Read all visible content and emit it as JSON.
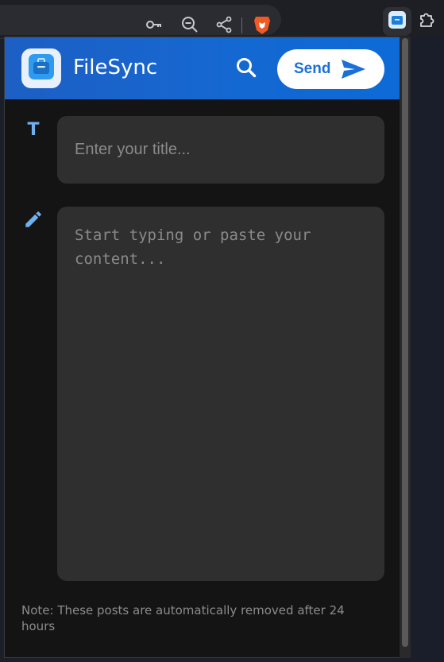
{
  "app": {
    "title": "FileSync"
  },
  "header": {
    "send_label": "Send"
  },
  "form": {
    "title_icon_glyph": "T",
    "title_placeholder": "Enter your title...",
    "title_value": "",
    "content_placeholder": "Start typing or paste your content...",
    "content_value": ""
  },
  "footer": {
    "note": "Note: These posts are automatically removed after 24 hours"
  },
  "icons": {
    "browser": [
      "key-icon",
      "zoom-out-icon",
      "share-icon",
      "brave-shield-icon",
      "extension-icon",
      "puzzle-icon"
    ],
    "popup": [
      "filesync-logo-icon",
      "search-icon",
      "send-icon",
      "title-icon",
      "pencil-icon"
    ]
  },
  "colors": {
    "header_gradient_start": "#1d5fc4",
    "header_gradient_end": "#0d6ad6",
    "accent": "#1b6fd8",
    "popup_background": "#141414",
    "field_background": "#2f2f2f",
    "placeholder": "#8a8a8a",
    "note_text": "#8c8c8c"
  }
}
